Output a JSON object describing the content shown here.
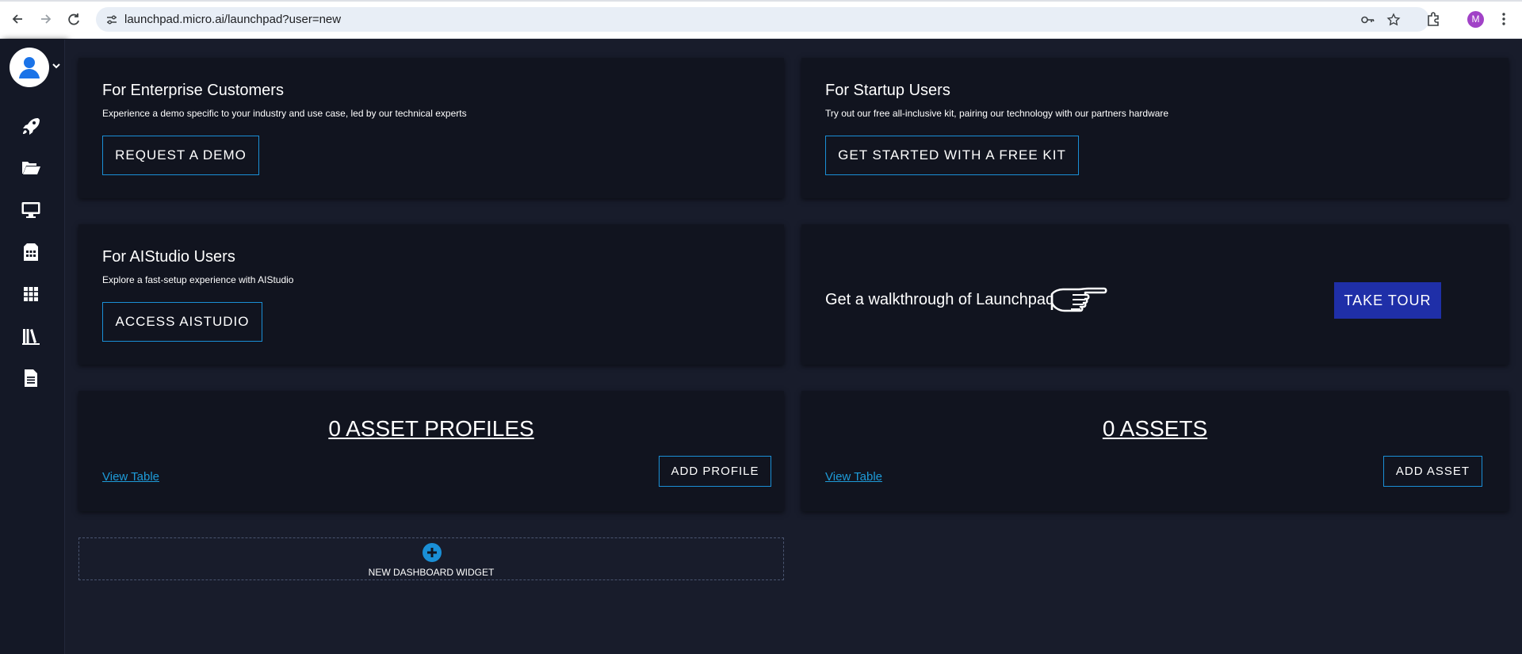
{
  "browser": {
    "url": "launchpad.micro.ai/launchpad?user=new",
    "profile_initial": "M"
  },
  "sidebar": {
    "items": [
      {
        "icon": "rocket-icon"
      },
      {
        "icon": "folder-open-icon"
      },
      {
        "icon": "monitor-icon"
      },
      {
        "icon": "sim-card-icon"
      },
      {
        "icon": "apps-grid-icon"
      },
      {
        "icon": "library-icon"
      },
      {
        "icon": "document-icon"
      }
    ]
  },
  "cards": {
    "enterprise": {
      "title": "For Enterprise Customers",
      "description": "Experience a demo specific to your industry and use case, led by our technical experts",
      "button": "REQUEST A DEMO"
    },
    "startup": {
      "title": "For Startup Users",
      "description": "Try out our free all-inclusive kit, pairing our technology with our partners hardware",
      "button": "GET STARTED WITH A FREE KIT"
    },
    "aistudio": {
      "title": "For AIStudio Users",
      "description": "Explore a fast-setup experience with AIStudio",
      "button": "ACCESS AISTUDIO"
    },
    "walkthrough": {
      "text": "Get a walkthrough of Launchpad",
      "button": "TAKE TOUR"
    },
    "asset_profiles": {
      "count_label": "0 ASSET PROFILES",
      "link": "View Table",
      "button": "ADD PROFILE"
    },
    "assets": {
      "count_label": "0 ASSETS",
      "link": "View Table",
      "button": "ADD ASSET"
    }
  },
  "new_widget": {
    "label": "NEW DASHBOARD WIDGET"
  },
  "colors": {
    "accent": "#1a8fd6",
    "tour_button": "#1f2fa8",
    "card_bg": "#11141f",
    "page_bg": "#181c2b"
  }
}
